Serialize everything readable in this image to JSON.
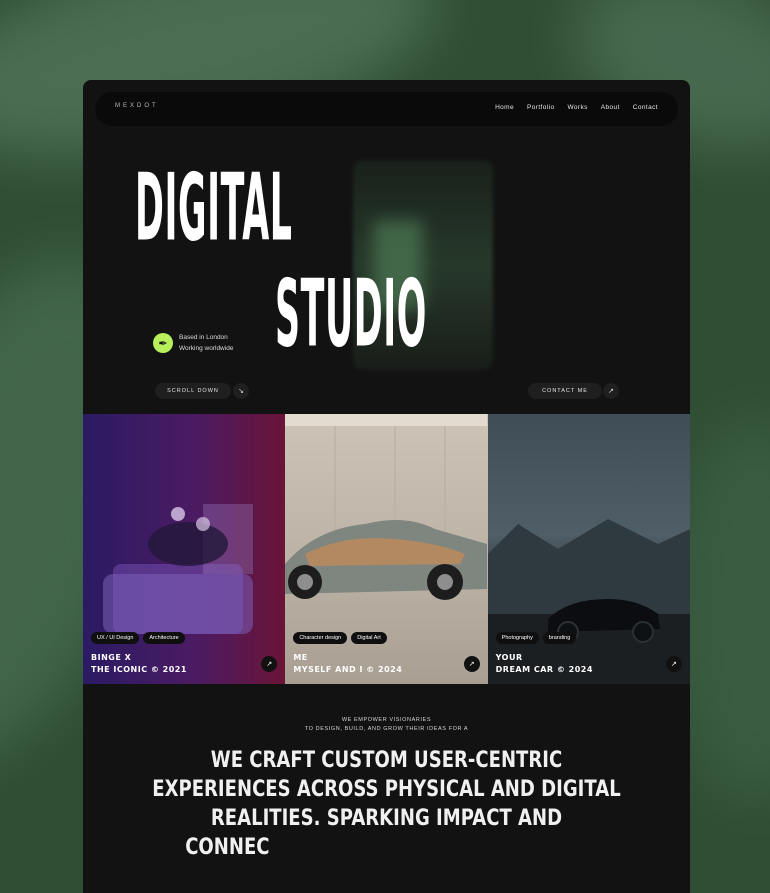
{
  "nav": {
    "logo": "MEXDOT",
    "links": [
      "Home",
      "Portfolio",
      "Works",
      "About",
      "Contact"
    ]
  },
  "hero": {
    "line1": "DIGITAL",
    "line2": "STUDIO",
    "based_line1": "Based in London",
    "based_line2": "Working worldwide",
    "scroll_label": "SCROLL DOWN",
    "contact_label": "CONTACT ME"
  },
  "cards": [
    {
      "tags": [
        "UX / UI Design",
        "Architecture"
      ],
      "title_line1": "BINGE X",
      "title_line2": "THE ICONIC © 2021"
    },
    {
      "tags": [
        "Character design",
        "Digital Art"
      ],
      "title_line1": "ME",
      "title_line2": "MYSELF AND I © 2024"
    },
    {
      "tags": [
        "Photography",
        "branding"
      ],
      "title_line1": "YOUR",
      "title_line2": "DREAM CAR © 2024"
    }
  ],
  "mission": {
    "small_line1": "WE EMPOWER VISIONARIES",
    "small_line2": "TO DESIGN, BUILD, AND GROW THEIR IDEAS FOR A",
    "big_line1": "WE CRAFT CUSTOM USER-CENTRIC",
    "big_line2": "EXPERIENCES ACROSS PHYSICAL AND DIGITAL",
    "big_line3": "REALITIES. SPARKING IMPACT AND",
    "big_line4": "CONNEC"
  },
  "colors": {
    "accent": "#b7f05b",
    "background": "#121212",
    "outer": "#2f4f35"
  }
}
